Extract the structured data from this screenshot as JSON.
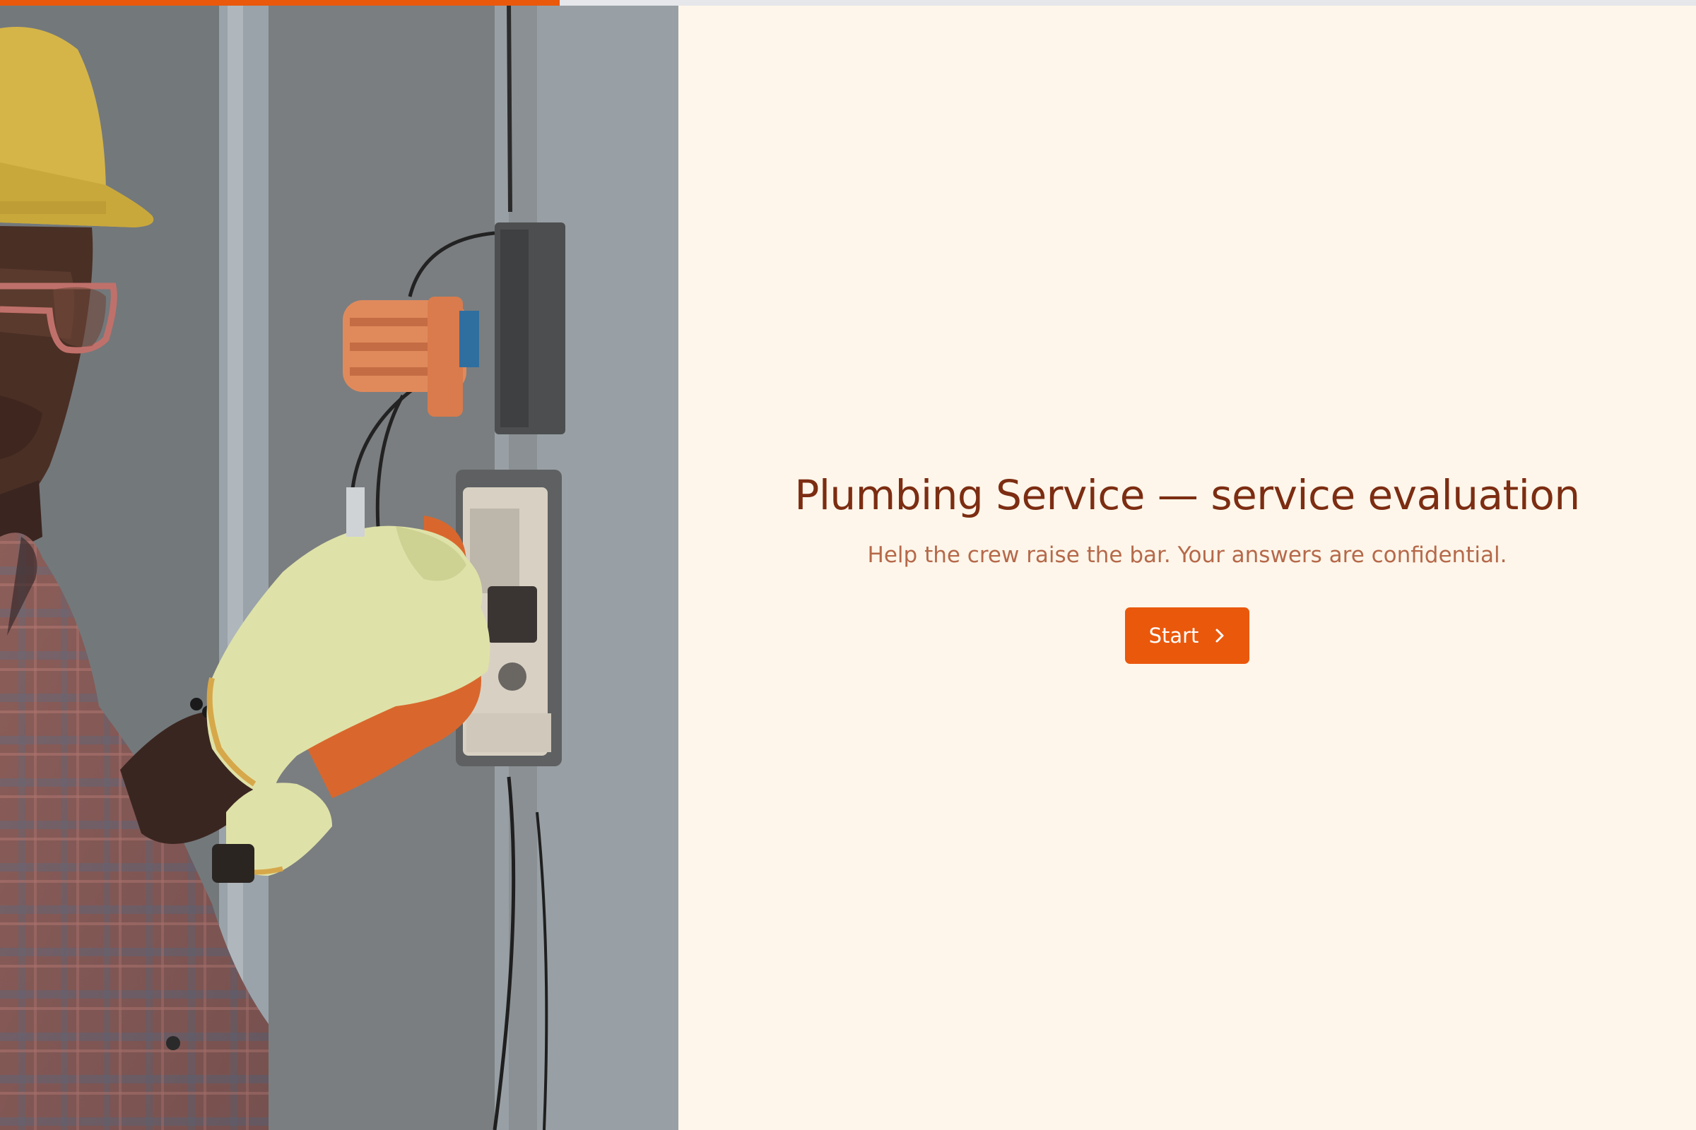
{
  "progress": {
    "fraction": 0.33
  },
  "hero": {
    "image_alt": "electrician-working-on-meter-photo"
  },
  "intro": {
    "title": "Plumbing Service — service evaluation",
    "subtitle": "Help the crew raise the bar. Your answers are confidential.",
    "start_label": "Start",
    "start_icon": "chevron-right-icon"
  },
  "colors": {
    "accent": "#ea580c",
    "title": "#7c2d12",
    "subtitle": "#b5694a",
    "background": "#fef6ea",
    "progress_track": "#e5e7eb"
  }
}
